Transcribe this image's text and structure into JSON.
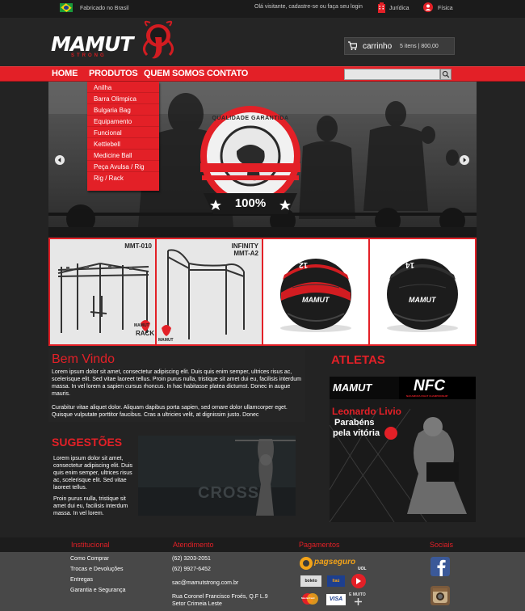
{
  "topbar": {
    "made_in": "Fabricado no Brasil",
    "visitor_text": "Olá visitante, cadastre-se ou faça seu login",
    "juridica": "Jurídica",
    "fisica": "Física"
  },
  "brand": {
    "name": "MAMUT",
    "sub": "STRONG"
  },
  "cart": {
    "label": "carrinho",
    "summary": "5 itens  |  800,00"
  },
  "nav": {
    "items": [
      "HOME",
      "PRODUTOS",
      "QUEM SOMOS",
      "CONTATO"
    ],
    "dropdown": [
      "Anilha",
      "Barra Olimpica",
      "Bulgaria Bag",
      "Equipamento",
      "Funcional",
      "Kettlebell",
      "Medicine Ball",
      "Peça Avulsa / Rig",
      "Rig / Rack"
    ]
  },
  "banner": {
    "seal_text": "QUALIDADE GARANTIDA",
    "percent": "100%"
  },
  "products": [
    {
      "name": "MMT-010",
      "tag": "RACK"
    },
    {
      "name": "INFINITY\nMMT-A2"
    },
    {
      "number": "12"
    },
    {
      "number": "14"
    }
  ],
  "welcome": {
    "title": "Bem Vindo",
    "p1": "Lorem ipsum dolor sit amet, consectetur adipiscing elit. Duis quis enim semper, ultrices risus ac, scelerisque elit. Sed vitae laoreet tellus. Proin purus nulla, tristique sit amet dui eu, facilisis interdum massa. In vel lorem a sapien cursus rhoncus. In hac habitasse platea dictumst. Donec in augue mauris.",
    "p2": "Curabitur vitae aliquet dolor. Aliquam dapibus porta sapien, sed ornare dolor ullamcorper eget. Quisque vulputate porttitor faucibus. Cras a ultricies velit, at dignissim justo. Donec"
  },
  "atletas": {
    "title": "ATLETAS",
    "event": "NFC",
    "event_sub": "NAKAMURA FIGHT CHAMPIONSHIP",
    "athlete": "Leonardo Livio",
    "message1": "Parabéns",
    "message2": "pela vitória"
  },
  "sugestoes": {
    "title": "SUGESTÕES",
    "p1": "Lorem ipsum dolor sit amet, consectetur adipiscing elit. Duis quis enim semper, ultrices risus ac, scelerisque elit. Sed vitae laoreet tellus.",
    "p2": "Proin purus nulla, tristique sit amet dui eu, facilisis interdum massa. In vel lorem.",
    "img_text": "CROSS"
  },
  "footer": {
    "institucional": {
      "title": "Institucional",
      "links": [
        "Como Comprar",
        "Trocas e Devoluções",
        "Entregas",
        "Garantia e Segurança"
      ]
    },
    "atendimento": {
      "title": "Atendimento",
      "phone1": "(62) 3203-2051",
      "phone2": "(62) 9927-6452",
      "email": "sac@mamutstrong.com.br",
      "address1": "Rua Coronel Francisco Froés, Q.F L.9",
      "address2": "Setor Crimeia Leste"
    },
    "pagamentos": {
      "title": "Pagamentos",
      "pagseguro": "pagseguro",
      "uol": "UOL",
      "boleto": "boleto",
      "itau": "Itaú",
      "mastercard": "MasterCard",
      "visa": "VISA",
      "more": "E MUITO"
    },
    "sociais": {
      "title": "Sociais"
    }
  },
  "colors": {
    "accent": "#e32027",
    "dark": "#232323",
    "footer": "#484848"
  }
}
